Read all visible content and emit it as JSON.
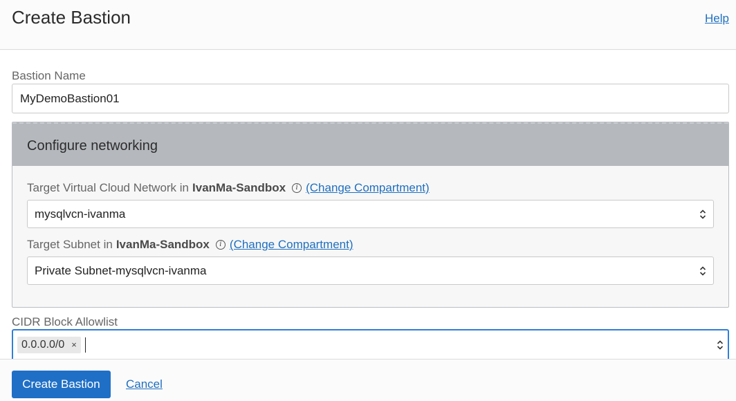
{
  "header": {
    "title": "Create Bastion",
    "help_label": "Help"
  },
  "form": {
    "bastion_name": {
      "label": "Bastion Name",
      "value": "MyDemoBastion01"
    },
    "networking": {
      "title": "Configure networking",
      "vcn": {
        "label_prefix": "Target Virtual Cloud Network in",
        "compartment": "IvanMa-Sandbox",
        "change_label": "(Change Compartment)",
        "selected": "mysqlvcn-ivanma"
      },
      "subnet": {
        "label_prefix": "Target Subnet in",
        "compartment": "IvanMa-Sandbox",
        "change_label": "(Change Compartment)",
        "selected": "Private Subnet-mysqlvcn-ivanma"
      }
    },
    "cidr": {
      "label": "CIDR Block Allowlist",
      "tags": [
        "0.0.0.0/0"
      ],
      "remove_glyph": "×"
    }
  },
  "footer": {
    "submit_label": "Create Bastion",
    "cancel_label": "Cancel"
  },
  "icons": {
    "info": "i",
    "select_arrows": "up-down-chevron-icon"
  },
  "colors": {
    "accent": "#1f6fc6",
    "link": "#1f6fbf",
    "focus_border": "#2f7fd8",
    "panel_header": "#b5b9be"
  }
}
